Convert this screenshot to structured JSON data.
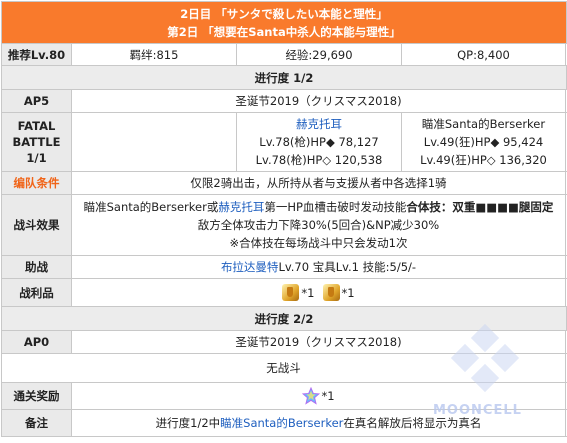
{
  "header": {
    "title_jp": "2日目 「サンタで殺したい本能と理性」",
    "title_cn": "第2日 「想要在Santa中杀人的本能与理性」"
  },
  "rewards": {
    "label": "推荐Lv.80",
    "bond": "羁绊:815",
    "exp": "经验:29,690",
    "qp": "QP:8,400"
  },
  "progress1": {
    "title": "进行度 1/2"
  },
  "ap5": {
    "label": "AP5",
    "value": "圣诞节2019（クリスマス2018)"
  },
  "battle": {
    "label_line1": "FATAL",
    "label_line2": "BATTLE",
    "label_line3": "1/1",
    "enemy1": {
      "name": "赫克托耳",
      "line1": "Lv.78(枪)HP◆ 78,127",
      "line2": "Lv.78(枪)HP◇ 120,538"
    },
    "enemy2": {
      "name": "瞄准Santa的Berserker",
      "line1": "Lv.49(狂)HP◆ 95,424",
      "line2": "Lv.49(狂)HP◇ 136,320"
    }
  },
  "formation": {
    "label": "编队条件",
    "value": "仅限2骑出击，从所持从者与支援从者中各选择1骑"
  },
  "effect": {
    "label": "战斗效果",
    "line1_a": "瞄准Santa的Berserker",
    "line1_b": "或",
    "line1_c": "赫克托耳",
    "line1_d": "第一HP血槽击破时发动技能",
    "line1_e": "合体技：双重■■■■腿固定",
    "line2": "敌方全体攻击力下降30%(5回合)&NP减少30%",
    "line3": "※合体技在每场战斗中只会发动1次"
  },
  "support": {
    "label": "助战",
    "servant": "布拉达曼特",
    "detail": " Lv.70 宝具Lv.1 技能:5/5/-"
  },
  "loot": {
    "label": "战利品",
    "count1": "*1",
    "count2": "*1"
  },
  "progress2": {
    "title": "进行度 2/2"
  },
  "ap0": {
    "label": "AP0",
    "value": "圣诞节2019（クリスマス2018)"
  },
  "nobattle": {
    "value": "无战斗"
  },
  "clear": {
    "label": "通关奖励",
    "count": "*1"
  },
  "note": {
    "label": "备注",
    "prefix": "进行度1/2中",
    "servant": "瞄准Santa的Berserker",
    "suffix": "在真名解放后将显示为真名"
  },
  "watermark": {
    "text": "MOONCELL"
  },
  "colors": {
    "header": "#f97a2c",
    "link": "#1f5fbf",
    "orange_label": "#f0651a",
    "label_bg": "#eaeaea"
  }
}
